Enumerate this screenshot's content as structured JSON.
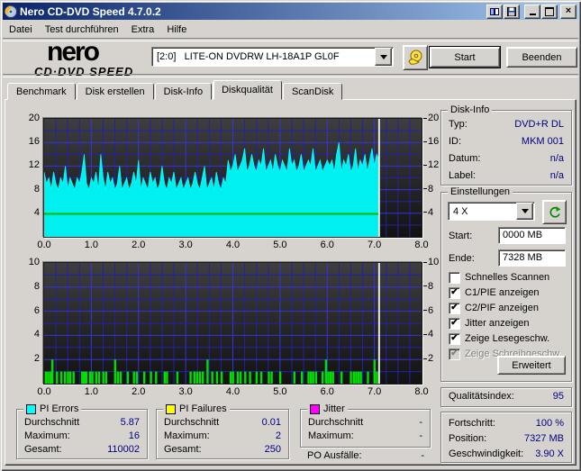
{
  "window": {
    "title": "Nero CD-DVD Speed 4.7.0.2",
    "controls": {
      "copy": "copy",
      "save": "save",
      "minimize": "_",
      "maximize": "max",
      "close": "×"
    }
  },
  "menu": {
    "items": [
      "Datei",
      "Test durchführen",
      "Extra",
      "Hilfe"
    ]
  },
  "toolbar": {
    "logo_line1": "nero",
    "logo_line2": "CD·DVD SPEED",
    "drive": "[2:0]   LITE-ON DVDRW LH-18A1P GL0F",
    "start_label": "Start",
    "quit_label": "Beenden"
  },
  "tabs": {
    "items": [
      "Benchmark",
      "Disk erstellen",
      "Disk-Info",
      "Diskqualität",
      "ScanDisk"
    ],
    "active_index": 3
  },
  "disk_info": {
    "title": "Disk-Info",
    "rows": [
      {
        "label": "Typ:",
        "value": "DVD+R DL"
      },
      {
        "label": "ID:",
        "value": "MKM 001"
      },
      {
        "label": "Datum:",
        "value": "n/a"
      },
      {
        "label": "Label:",
        "value": "n/a"
      }
    ]
  },
  "settings": {
    "title": "Einstellungen",
    "speed_value": "4 X",
    "start_label": "Start:",
    "start_value": "0000 MB",
    "end_label": "Ende:",
    "end_value": "7328 MB",
    "checkboxes": [
      {
        "label": "Schnelles Scannen",
        "checked": false,
        "disabled": false
      },
      {
        "label": "C1/PIE anzeigen",
        "checked": true,
        "disabled": false
      },
      {
        "label": "C2/PIF anzeigen",
        "checked": true,
        "disabled": false
      },
      {
        "label": "Jitter anzeigen",
        "checked": true,
        "disabled": false
      },
      {
        "label": "Zeige Lesegeschw.",
        "checked": true,
        "disabled": false
      },
      {
        "label": "Zeige Schreibgeschw.",
        "checked": true,
        "disabled": true
      }
    ],
    "advanced_label": "Erweitert"
  },
  "quality": {
    "label": "Qualitätsindex:",
    "value": "95"
  },
  "progress": {
    "rows": [
      {
        "label": "Fortschritt:",
        "value": "100 %"
      },
      {
        "label": "Position:",
        "value": "7327 MB"
      },
      {
        "label": "Geschwindigkeit:",
        "value": "3.90 X"
      }
    ]
  },
  "stats": {
    "pi_errors": {
      "title": "PI Errors",
      "swatch": "#00ffff",
      "rows": [
        {
          "label": "Durchschnitt",
          "value": "5.87"
        },
        {
          "label": "Maximum:",
          "value": "16"
        },
        {
          "label": "Gesamt:",
          "value": "110002"
        }
      ]
    },
    "pi_failures": {
      "title": "PI Failures",
      "swatch": "#ffff00",
      "rows": [
        {
          "label": "Durchschnitt",
          "value": "0.01"
        },
        {
          "label": "Maximum:",
          "value": "2"
        },
        {
          "label": "Gesamt:",
          "value": "250"
        }
      ]
    },
    "jitter": {
      "title": "Jitter",
      "swatch": "#ff00ff",
      "rows": [
        {
          "label": "Durchschnitt",
          "value": "-"
        },
        {
          "label": "Maximum:",
          "value": "-"
        }
      ]
    },
    "po_failures": {
      "label": "PO Ausfälle:",
      "value": "-"
    }
  },
  "chart_data": [
    {
      "type": "area",
      "name": "PI Errors",
      "color": "#00f0f0",
      "xlim": [
        0,
        8
      ],
      "ylim": [
        0,
        20
      ],
      "x_ticks": [
        "0.0",
        "1.0",
        "2.0",
        "3.0",
        "4.0",
        "5.0",
        "6.0",
        "7.0",
        "8.0"
      ],
      "y_ticks": [
        4,
        8,
        12,
        16,
        20
      ],
      "grid": {
        "x_minor_step": 0.25,
        "x_major_step": 1.0,
        "y_minor_step": 2,
        "y_major_step": 4
      },
      "sample_interval_gb": 0.05,
      "end_marker_x": 7.1,
      "values": [
        11,
        9,
        10,
        8,
        11,
        9,
        8,
        10,
        9,
        12,
        8,
        10,
        9,
        8,
        10,
        9,
        11,
        14,
        9,
        8,
        10,
        9,
        11,
        8,
        14,
        10,
        8,
        11,
        9,
        10,
        8,
        9,
        12,
        8,
        9,
        10,
        8,
        9,
        11,
        9,
        13,
        8,
        10,
        9,
        8,
        11,
        9,
        10,
        8,
        9,
        12,
        9,
        8,
        10,
        9,
        11,
        8,
        9,
        10,
        8,
        9,
        10,
        8,
        9,
        11,
        9,
        8,
        10,
        12,
        8,
        9,
        10,
        8,
        11,
        9,
        8,
        10,
        9,
        13,
        11,
        12,
        14,
        11,
        12,
        13,
        15,
        11,
        12,
        14,
        12,
        11,
        13,
        12,
        15,
        11,
        12,
        13,
        11,
        14,
        12,
        11,
        13,
        12,
        11,
        15,
        12,
        13,
        11,
        12,
        14,
        11,
        12,
        13,
        12,
        15,
        11,
        12,
        13,
        11,
        12,
        13,
        12,
        13,
        11,
        14,
        16,
        11,
        13,
        12,
        14,
        11,
        12,
        15,
        11,
        13,
        12,
        14,
        11,
        13,
        15,
        12,
        14,
        13
      ],
      "speed_line": {
        "name": "Lesegeschwindigkeit",
        "color": "#00b400",
        "value": 3.9,
        "x_start": 0,
        "x_end": 7.1
      }
    },
    {
      "type": "bar",
      "name": "PI Failures",
      "color": "#00dd00",
      "xlim": [
        0,
        8
      ],
      "ylim": [
        0,
        10
      ],
      "x_ticks": [
        "0.0",
        "1.0",
        "2.0",
        "3.0",
        "4.0",
        "5.0",
        "6.0",
        "7.0",
        "8.0"
      ],
      "y_ticks": [
        2,
        4,
        6,
        8,
        10
      ],
      "grid": {
        "x_minor_step": 0.25,
        "x_major_step": 1.0,
        "y_minor_step": 1,
        "y_major_step": 2
      },
      "end_marker_x": 7.1,
      "bars": [
        [
          0.03,
          1
        ],
        [
          0.08,
          1
        ],
        [
          0.13,
          1
        ],
        [
          0.17,
          2
        ],
        [
          0.27,
          1
        ],
        [
          0.36,
          1
        ],
        [
          0.44,
          1
        ],
        [
          0.5,
          1
        ],
        [
          0.55,
          1
        ],
        [
          0.62,
          1
        ],
        [
          0.8,
          1
        ],
        [
          0.83,
          1
        ],
        [
          0.86,
          1
        ],
        [
          0.89,
          1
        ],
        [
          0.97,
          1
        ],
        [
          1.02,
          1
        ],
        [
          1.1,
          1
        ],
        [
          1.16,
          1
        ],
        [
          1.25,
          1
        ],
        [
          1.31,
          1
        ],
        [
          1.5,
          2
        ],
        [
          1.56,
          1
        ],
        [
          1.62,
          1
        ],
        [
          1.77,
          1
        ],
        [
          1.9,
          1
        ],
        [
          1.96,
          1
        ],
        [
          2.12,
          1
        ],
        [
          2.26,
          1
        ],
        [
          2.37,
          1
        ],
        [
          2.55,
          1
        ],
        [
          2.6,
          1
        ],
        [
          2.82,
          1
        ],
        [
          3.1,
          1
        ],
        [
          3.18,
          1
        ],
        [
          3.24,
          1
        ],
        [
          3.3,
          1
        ],
        [
          3.36,
          1
        ],
        [
          3.46,
          2
        ],
        [
          3.56,
          1
        ],
        [
          3.66,
          1
        ],
        [
          3.76,
          1
        ],
        [
          3.95,
          1
        ],
        [
          4.0,
          1
        ],
        [
          4.1,
          1
        ],
        [
          4.16,
          1
        ],
        [
          4.26,
          1
        ],
        [
          4.36,
          1
        ],
        [
          4.5,
          1
        ],
        [
          4.6,
          1
        ],
        [
          4.76,
          1
        ],
        [
          4.82,
          1
        ],
        [
          5.0,
          1
        ],
        [
          5.3,
          1
        ],
        [
          5.46,
          1
        ],
        [
          5.6,
          1
        ],
        [
          5.65,
          1
        ],
        [
          5.7,
          1
        ],
        [
          5.76,
          1
        ],
        [
          5.9,
          1
        ],
        [
          5.97,
          2
        ],
        [
          6.02,
          1
        ],
        [
          6.07,
          1
        ],
        [
          6.12,
          1
        ],
        [
          6.3,
          1
        ],
        [
          6.5,
          1
        ],
        [
          6.56,
          1
        ],
        [
          6.61,
          1
        ],
        [
          6.66,
          1
        ],
        [
          6.71,
          1
        ],
        [
          6.86,
          1
        ],
        [
          7.0,
          2
        ],
        [
          7.05,
          1
        ]
      ]
    }
  ]
}
